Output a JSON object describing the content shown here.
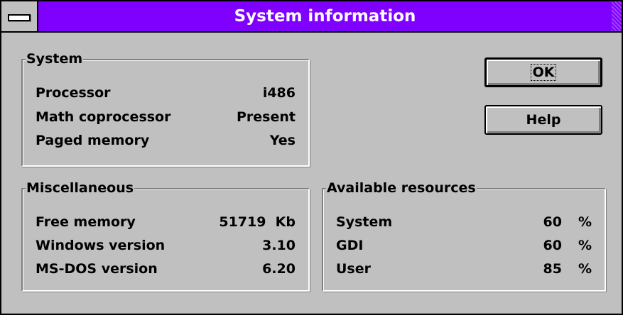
{
  "window": {
    "title": "System information",
    "system_menu_icon": "system-menu-bar-icon"
  },
  "system_group": {
    "label": "System",
    "rows": [
      {
        "label": "Processor",
        "value": "i486"
      },
      {
        "label": "Math coprocessor",
        "value": "Present"
      },
      {
        "label": "Paged memory",
        "value": "Yes"
      }
    ]
  },
  "misc_group": {
    "label": "Miscellaneous",
    "rows": [
      {
        "label": "Free memory",
        "value": "51719  Kb"
      },
      {
        "label": "Windows version",
        "value": "3.10"
      },
      {
        "label": "MS-DOS version",
        "value": "6.20"
      }
    ]
  },
  "resources_group": {
    "label": "Available resources",
    "rows": [
      {
        "label": "System",
        "value": "60",
        "unit": "%"
      },
      {
        "label": "GDI",
        "value": "60",
        "unit": "%"
      },
      {
        "label": "User",
        "value": "85",
        "unit": "%"
      }
    ]
  },
  "buttons": {
    "ok_label": "OK",
    "help_label": "Help"
  },
  "colors": {
    "title_bar": "#8000ff",
    "face": "#c0c0c0"
  }
}
